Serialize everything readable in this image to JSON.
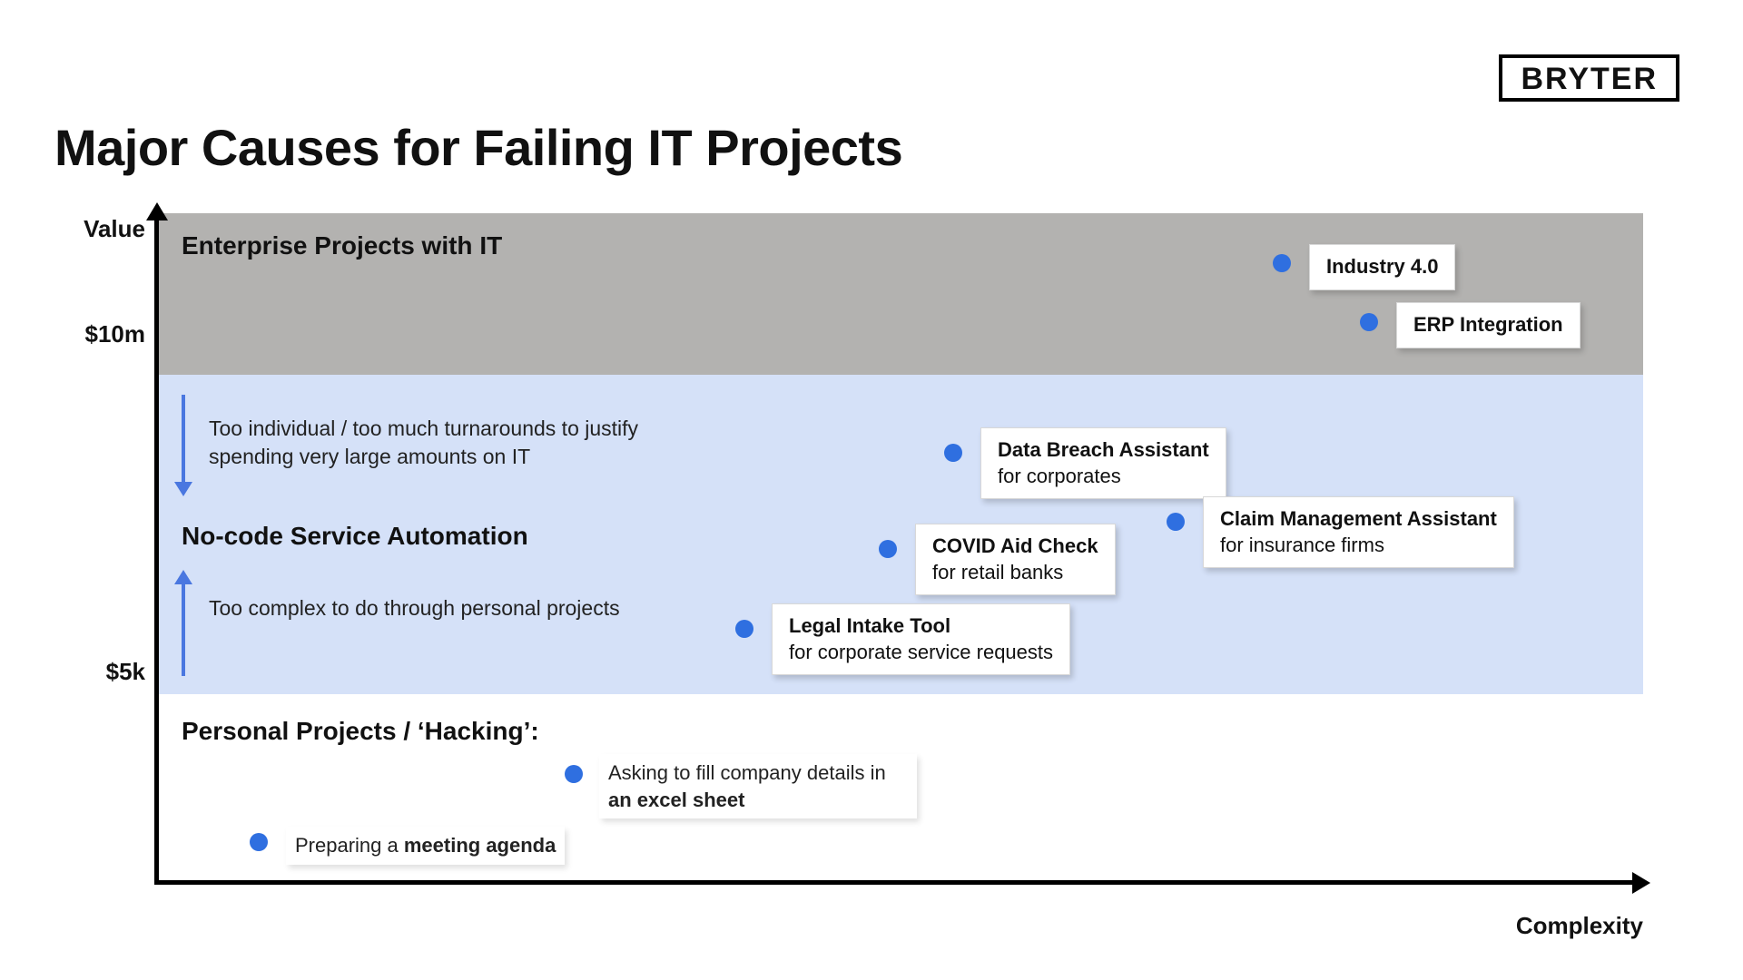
{
  "brand": "BRYTER",
  "title": "Major Causes for Failing IT Projects",
  "axes": {
    "y_label": "Value",
    "x_label": "Complexity",
    "y_ticks": [
      "$10m",
      "$5k"
    ]
  },
  "bands": {
    "top_title": "Enterprise Projects with IT",
    "mid_title": "No-code Service Automation",
    "bottom_title": "Personal Projects / ‘Hacking’:"
  },
  "annotations": {
    "upper": "Too individual / too much turnarounds to justify spending very large amounts on IT",
    "lower": "Too complex to do through personal projects"
  },
  "points": {
    "industry40": {
      "title": "Industry 4.0",
      "sub": ""
    },
    "erp": {
      "title": "ERP Integration",
      "sub": ""
    },
    "breach": {
      "title": "Data Breach Assistant",
      "sub": "for corporates"
    },
    "claim": {
      "title": "Claim Management Assistant",
      "sub": "for insurance firms"
    },
    "covid": {
      "title": "COVID Aid Check",
      "sub": "for retail banks"
    },
    "legal": {
      "title": "Legal Intake Tool",
      "sub": "for corporate service requests"
    },
    "excel": {
      "line1": "Asking to fill company details in",
      "bold": "an excel sheet"
    },
    "agenda": {
      "line1": "Preparing a ",
      "bold": "meeting agenda"
    }
  },
  "chart_data": {
    "type": "scatter",
    "title": "Major Causes for Failing IT Projects",
    "xlabel": "Complexity",
    "ylabel": "Value",
    "x_range_note": "qualitative 0–100",
    "y_axis_markers": [
      {
        "label": "$10m",
        "value_usd": 10000000
      },
      {
        "label": "$5k",
        "value_usd": 5000
      }
    ],
    "bands": [
      {
        "name": "Enterprise Projects with IT",
        "value_range": "> $10m"
      },
      {
        "name": "No-code Service Automation",
        "value_range": "$5k – $10m"
      },
      {
        "name": "Personal Projects / ‘Hacking’",
        "value_range": "< $5k"
      }
    ],
    "series": [
      {
        "name": "Projects",
        "points": [
          {
            "label": "Industry 4.0",
            "band": "Enterprise Projects with IT",
            "complexity_pct": 74,
            "value_band_pos": "high"
          },
          {
            "label": "ERP Integration",
            "band": "Enterprise Projects with IT",
            "complexity_pct": 80,
            "value_band_pos": "mid"
          },
          {
            "label": "Data Breach Assistant for corporates",
            "band": "No-code Service Automation",
            "complexity_pct": 53,
            "value_band_pos": "high"
          },
          {
            "label": "Claim Management Assistant for insurance firms",
            "band": "No-code Service Automation",
            "complexity_pct": 67,
            "value_band_pos": "mid"
          },
          {
            "label": "COVID Aid Check for retail banks",
            "band": "No-code Service Automation",
            "complexity_pct": 49,
            "value_band_pos": "mid"
          },
          {
            "label": "Legal Intake Tool for corporate service requests",
            "band": "No-code Service Automation",
            "complexity_pct": 40,
            "value_band_pos": "low"
          },
          {
            "label": "Asking to fill company details in an excel sheet",
            "band": "Personal Projects / ‘Hacking’",
            "complexity_pct": 28,
            "value_band_pos": "high"
          },
          {
            "label": "Preparing a meeting agenda",
            "band": "Personal Projects / ‘Hacking’",
            "complexity_pct": 10,
            "value_band_pos": "low"
          }
        ]
      }
    ],
    "annotations": [
      "Too individual / too much turnarounds to justify spending very large amounts on IT",
      "Too complex to do through personal projects"
    ]
  }
}
